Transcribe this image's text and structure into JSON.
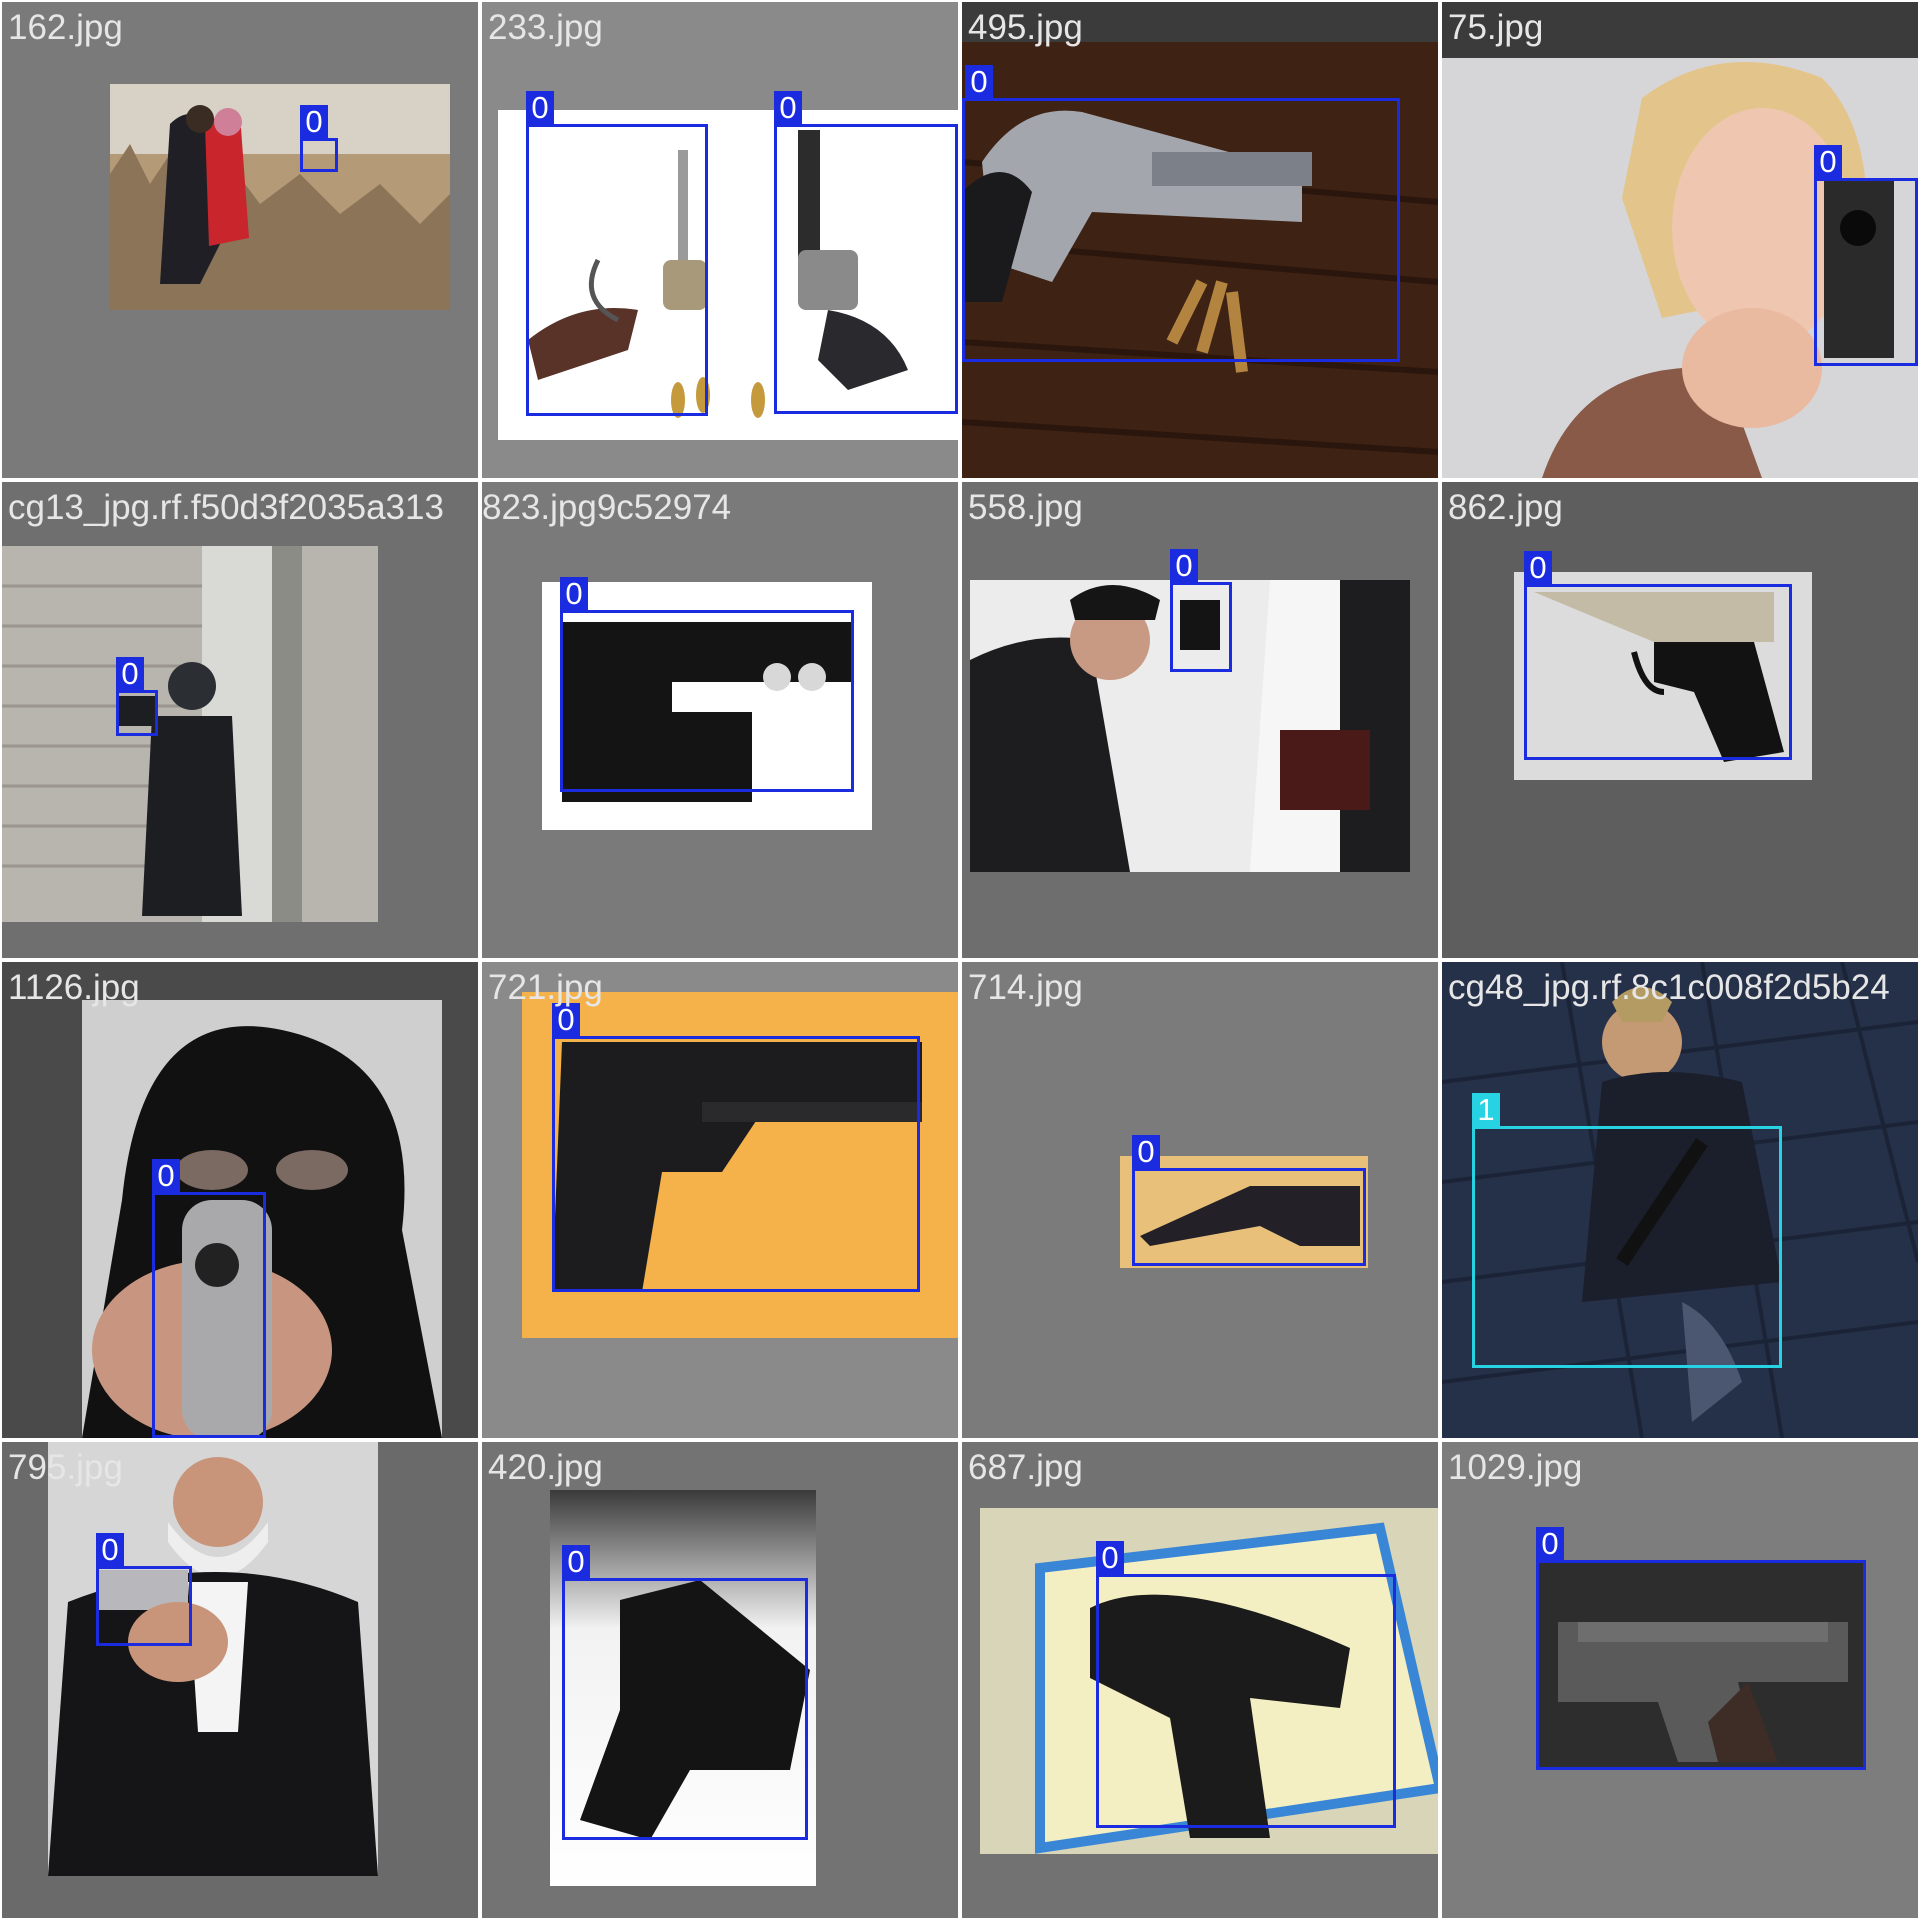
{
  "colors": {
    "class_0": "#1a2be0",
    "class_1": "#27d2e3"
  },
  "tiles": [
    {
      "file": "162.jpg",
      "labels": [
        {
          "cls": "0"
        }
      ]
    },
    {
      "file": "233.jpg",
      "labels": [
        {
          "cls": "0"
        },
        {
          "cls": "0"
        }
      ]
    },
    {
      "file": "495.jpg",
      "labels": [
        {
          "cls": "0"
        }
      ]
    },
    {
      "file": "75.jpg",
      "labels": [
        {
          "cls": "0"
        }
      ]
    },
    {
      "file": "cg13_jpg.rf.f50d3f2035a313",
      "labels": [
        {
          "cls": "0"
        }
      ]
    },
    {
      "file": "823.jpg9c52974",
      "labels": [
        {
          "cls": "0"
        }
      ]
    },
    {
      "file": "558.jpg",
      "labels": [
        {
          "cls": "0"
        }
      ]
    },
    {
      "file": "862.jpg",
      "labels": [
        {
          "cls": "0"
        }
      ]
    },
    {
      "file": "1126.jpg",
      "labels": [
        {
          "cls": "0"
        }
      ]
    },
    {
      "file": "721.jpg",
      "labels": [
        {
          "cls": "0"
        }
      ]
    },
    {
      "file": "714.jpg",
      "labels": [
        {
          "cls": "0"
        }
      ]
    },
    {
      "file": "cg48_jpg.rf.8c1c008f2d5b24",
      "labels": [
        {
          "cls": "1"
        }
      ]
    },
    {
      "file": "795.jpg",
      "labels": [
        {
          "cls": "0"
        }
      ]
    },
    {
      "file": "420.jpg",
      "labels": [
        {
          "cls": "0"
        }
      ]
    },
    {
      "file": "687.jpg",
      "labels": [
        {
          "cls": "0"
        }
      ]
    },
    {
      "file": "1029.jpg",
      "labels": [
        {
          "cls": "0"
        }
      ]
    }
  ]
}
